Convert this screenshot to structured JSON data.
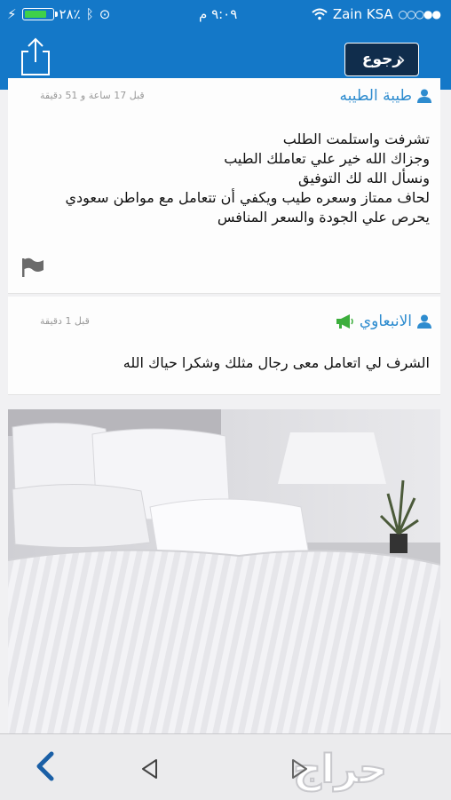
{
  "status_bar": {
    "carrier": "Zain KSA",
    "signal_dots": "○○○●●",
    "time": "٩:٠٩ م",
    "battery_percent": "٢٨٪"
  },
  "nav": {
    "back_label": "رجوع",
    "share_icon": "share-icon"
  },
  "comments": [
    {
      "author": "طيبة الطيبه",
      "time_ago": "قبل 17 ساعة و 51 دقيقة",
      "lines": [
        "تشرفت واستلمت الطلب",
        "وجزاك الله خير علي تعاملك الطيب",
        "ونسأل الله لك التوفيق",
        "لحاف ممتاز وسعره طيب ويكفي أن تتعامل مع مواطن سعودي",
        "يحرص علي الجودة والسعر المنافس"
      ]
    },
    {
      "author": "الانبعاوي",
      "time_ago": "قبل 1 دقيقة",
      "lines": [
        "الشرف لي اتعامل معى رجال مثلك وشكرا حياك الله"
      ]
    }
  ],
  "photo": {
    "subject": "white striped bedding set"
  },
  "bottom_bar": {
    "logo_text": "حراج"
  },
  "colors": {
    "accent": "#1478c8",
    "back_button": "#102d4c",
    "author_link": "#2e8ccf",
    "megaphone": "#3cae3c"
  }
}
